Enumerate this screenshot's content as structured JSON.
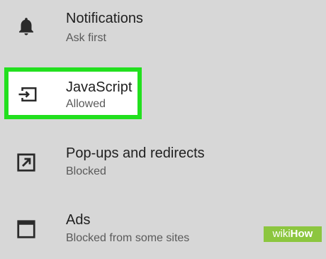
{
  "settings": {
    "items": [
      {
        "icon": "bell-icon",
        "title": "Notifications",
        "subtitle": "Ask first"
      },
      {
        "icon": "javascript-icon",
        "title": "JavaScript",
        "subtitle": "Allowed"
      },
      {
        "icon": "popup-redirect-icon",
        "title": "Pop-ups and redirects",
        "subtitle": "Blocked"
      },
      {
        "icon": "ads-icon",
        "title": "Ads",
        "subtitle": "Blocked from some sites"
      }
    ]
  },
  "watermark": {
    "part1": "wiki",
    "part2": "How"
  },
  "colors": {
    "background": "#d7d7d7",
    "highlight_border": "#22e01e",
    "highlight_fill": "#ffffff",
    "watermark": "#8cc63f"
  }
}
